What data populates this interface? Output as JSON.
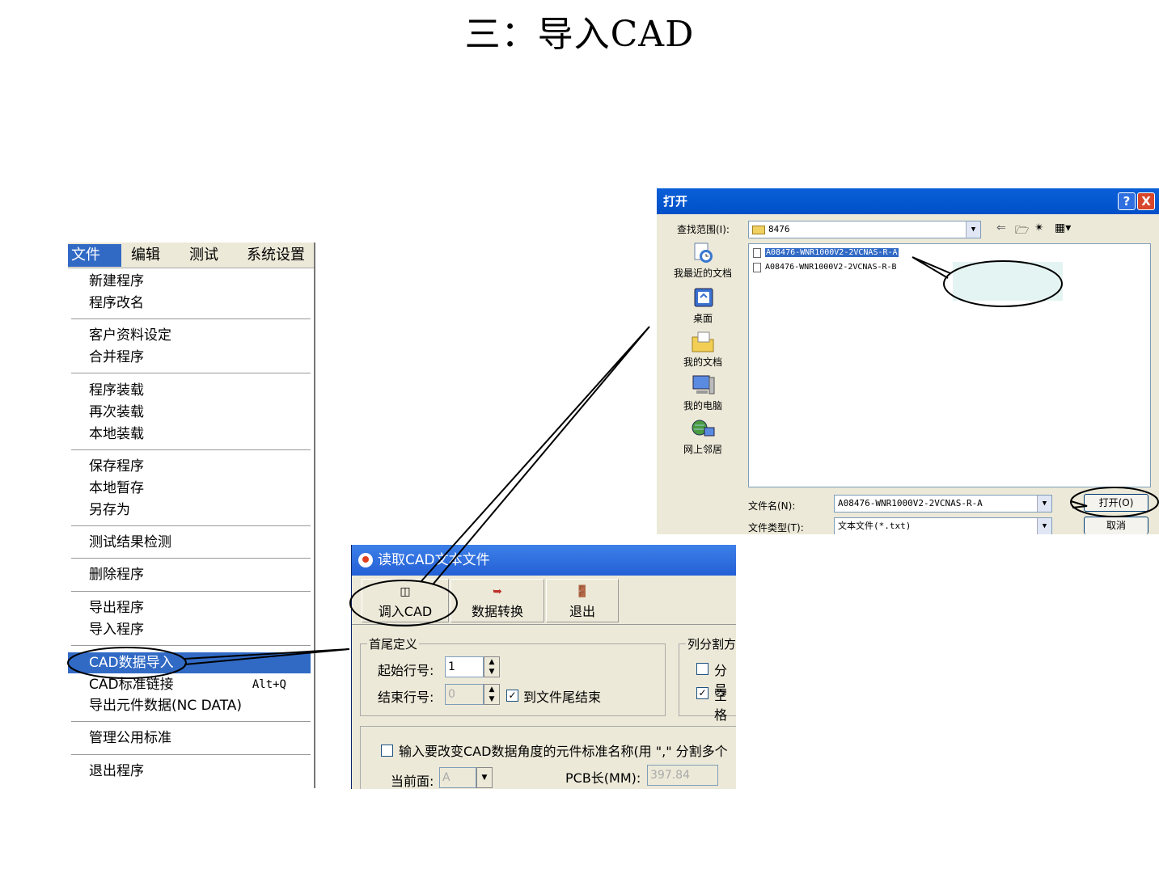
{
  "page": {
    "title": "三：导入CAD"
  },
  "menu": {
    "bar": [
      "文件",
      "编辑",
      "测试",
      "系统设置"
    ],
    "items": [
      {
        "label": "新建程序"
      },
      {
        "label": "程序改名"
      },
      {
        "label": "客户资料设定"
      },
      {
        "label": "合并程序"
      },
      {
        "label": "程序装载"
      },
      {
        "label": "再次装载"
      },
      {
        "label": "本地装载"
      },
      {
        "label": "保存程序"
      },
      {
        "label": "本地暂存"
      },
      {
        "label": "另存为"
      },
      {
        "label": "测试结果检测"
      },
      {
        "label": "删除程序"
      },
      {
        "label": "导出程序"
      },
      {
        "label": "导入程序"
      },
      {
        "label": "CAD数据导入"
      },
      {
        "label": "CAD标准链接",
        "shortcut": "Alt+Q"
      },
      {
        "label": "导出元件数据(NC DATA)"
      },
      {
        "label": "管理公用标准"
      },
      {
        "label": "退出程序"
      }
    ]
  },
  "cad_dialog": {
    "title": "读取CAD文本文件",
    "toolbar": {
      "import": "调入CAD",
      "convert": "数据转换",
      "exit": "退出"
    },
    "group_head_tail": "首尾定义",
    "start_row_label": "起始行号:",
    "start_row_value": "1",
    "end_row_label": "结束行号:",
    "end_row_value": "0",
    "to_end_label": "到文件尾结束",
    "group_col_split": "列分割方",
    "semicolon_label": "分号",
    "space_label": "空格",
    "angle_label": "输入要改变CAD数据角度的元件标准名称(用 \",\" 分割多个",
    "current_side_label": "当前面:",
    "current_side_value": "A",
    "pcb_len_label": "PCB长(MM):",
    "pcb_len_value": "397.84"
  },
  "open_dialog": {
    "title": "打开",
    "help": "?",
    "close": "X",
    "lookin_label": "查找范围(I):",
    "lookin_value": "8476",
    "places": [
      "我最近的文档",
      "桌面",
      "我的文档",
      "我的电脑",
      "网上邻居"
    ],
    "files": [
      "A08476-WNR1000V2-2VCNAS-R-A",
      "A08476-WNR1000V2-2VCNAS-R-B"
    ],
    "filename_label": "文件名(N):",
    "filename_value": "A08476-WNR1000V2-2VCNAS-R-A",
    "filetype_label": "文件类型(T):",
    "filetype_value": "文本文件(*.txt)",
    "open_button": "打开(O)",
    "cancel_button": "取消"
  },
  "colors": {
    "selection": "#316ac5",
    "xp_title": "#0a5fd8",
    "dialog_bg": "#ece9d8",
    "callout_fill": "#d8f0ec"
  }
}
